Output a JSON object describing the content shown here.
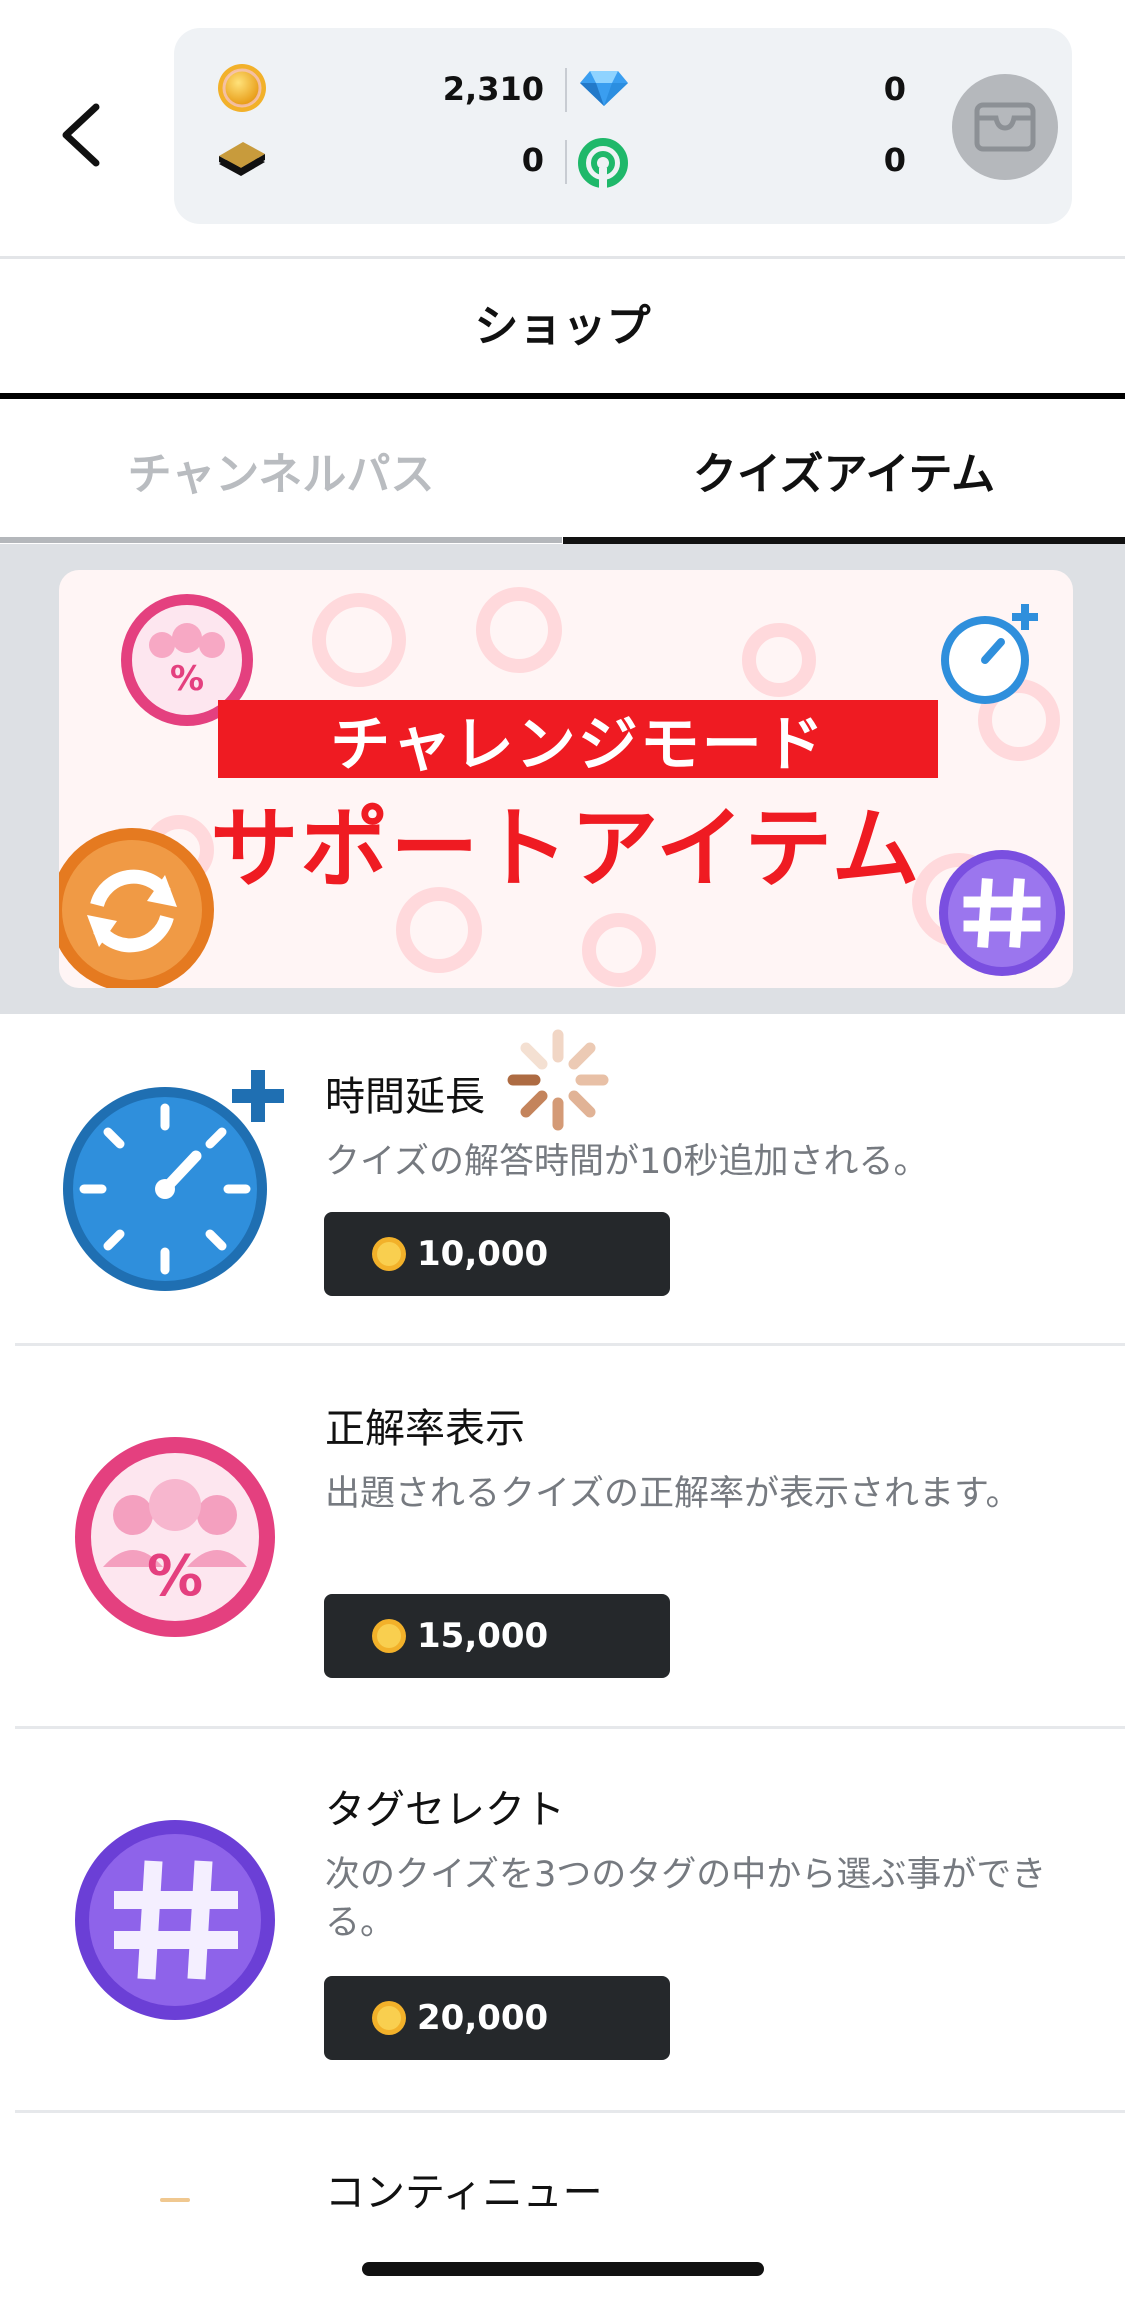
{
  "header": {
    "coins": "2,310",
    "gems": "0",
    "tickets": "0",
    "points": "0"
  },
  "page_title": "ショップ",
  "tabs": [
    {
      "label": "チャンネルパス",
      "active": false
    },
    {
      "label": "クイズアイテム",
      "active": true
    }
  ],
  "banner": {
    "line1": "チャレンジモード",
    "line2": "サポートアイテム"
  },
  "items": [
    {
      "name": "時間延長",
      "description": "クイズの解答時間が10秒追加される。",
      "price": "10,000",
      "icon": "stopwatch-plus-icon",
      "color": "#2f8fdc"
    },
    {
      "name": "正解率表示",
      "description": "出題されるクイズの正解率が表示されます。",
      "price": "15,000",
      "icon": "percent-people-icon",
      "color": "#e4407f"
    },
    {
      "name": "タグセレクト",
      "description": "次のクイズを3つのタグの中から選ぶ事ができる。",
      "price": "20,000",
      "icon": "hashtag-icon",
      "color": "#7a4fe0"
    },
    {
      "name": "コンティニュー",
      "description": "",
      "price": "",
      "icon": "continue-icon",
      "color": "#ef8432"
    }
  ]
}
